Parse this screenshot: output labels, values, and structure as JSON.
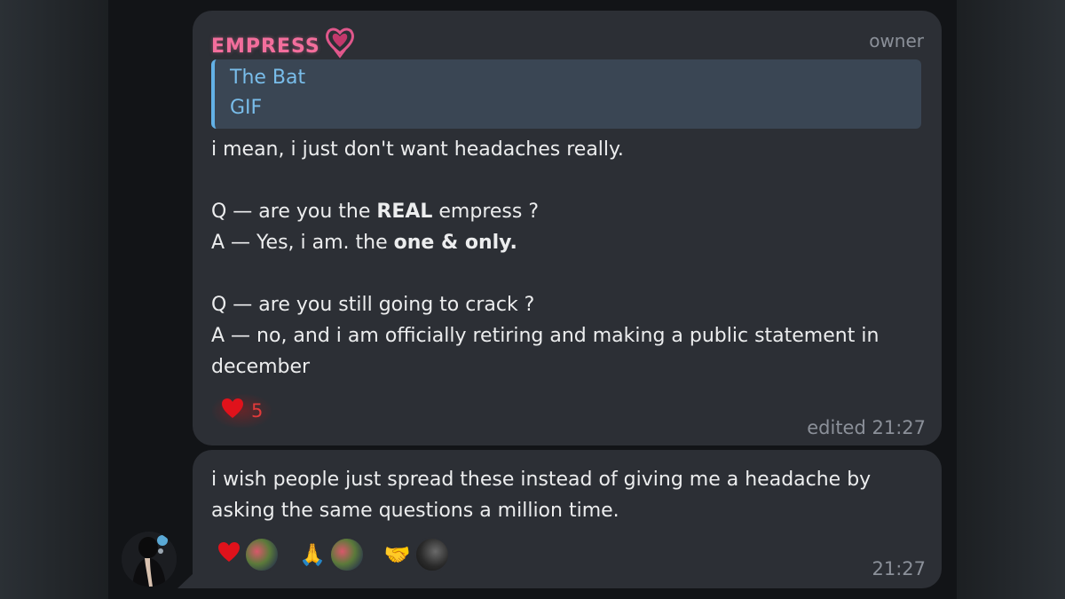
{
  "message1": {
    "sender": "EMPRESS",
    "role_badge": "owner",
    "reply": {
      "author": "The Bat",
      "media": "GIF"
    },
    "line1": "i mean, i just don't want headaches really.",
    "q1_a": "Q — are you the ",
    "q1_b": "REAL",
    "q1_c": " empress ?",
    "a1_a": "A — Yes, i am. the ",
    "a1_b": "one & only.",
    "q2": "Q — are you still going to crack ?",
    "a2_l1": "A — no, and i am officially retiring and making a public statement in",
    "a2_l2": "december",
    "reaction": {
      "emoji": "heart",
      "count": "5"
    },
    "timestamp": "edited 21:27"
  },
  "message2": {
    "line1": "i wish people just spread these instead of giving me a headache by",
    "line2": "asking the same questions a million time.",
    "reactions": [
      {
        "emoji": "heart",
        "glyph": "❤"
      },
      {
        "emoji": "folded-hands",
        "glyph": "🙏"
      },
      {
        "emoji": "handshake",
        "glyph": "🤝"
      }
    ],
    "timestamp": "21:27"
  },
  "colors": {
    "sender": "#f36e9c",
    "reply_accent": "#63b1e6",
    "bubble": "#2c2f35",
    "text": "#ecedee",
    "meta": "#8b9099",
    "reaction_red": "#e23a3a"
  }
}
